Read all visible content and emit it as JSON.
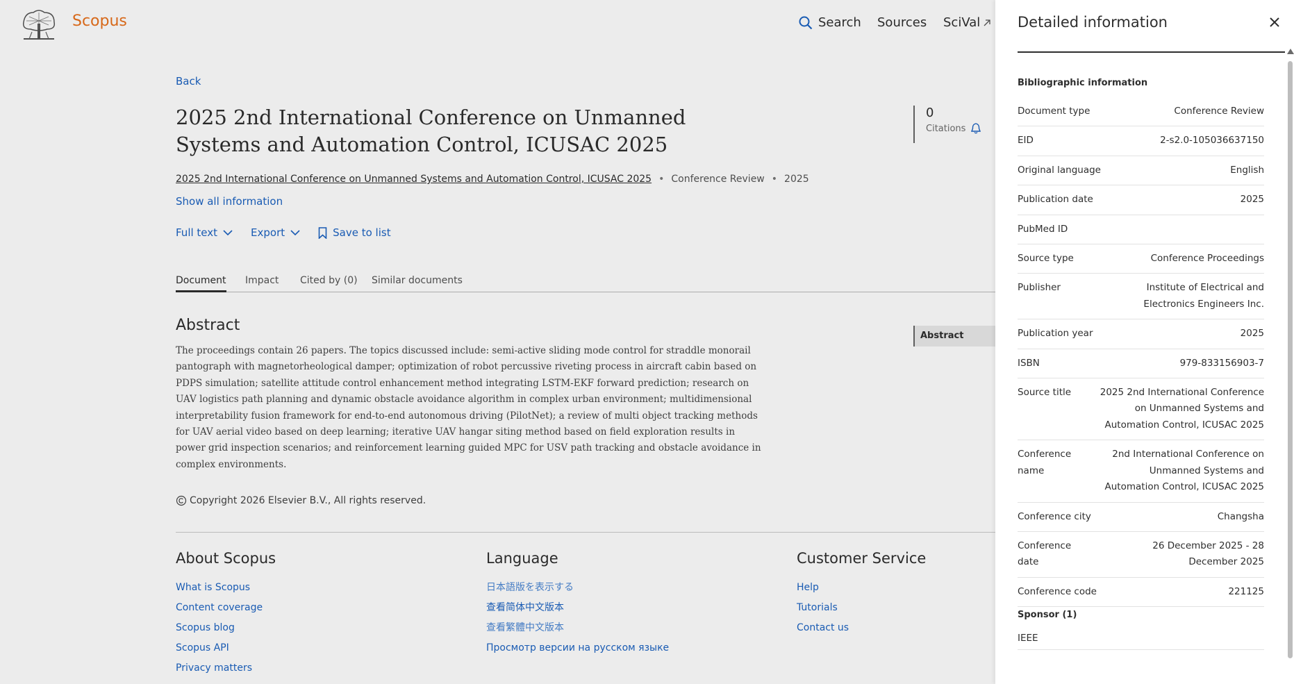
{
  "header": {
    "brand": "Scopus",
    "nav": {
      "search": "Search",
      "sources": "Sources",
      "scival": "SciVal"
    }
  },
  "main": {
    "back": "Back",
    "title": "2025 2nd International Conference on Unmanned Systems and Automation Control, ICUSAC 2025",
    "citations": {
      "count": "0",
      "label": "Citations"
    },
    "meta": {
      "source": "2025 2nd International Conference on Unmanned Systems and Automation Control, ICUSAC 2025",
      "doc_type": "Conference Review",
      "year": "2025"
    },
    "show_all": "Show all information",
    "actions": {
      "full_text": "Full text",
      "export": "Export",
      "save": "Save to list"
    },
    "tabs": [
      "Document",
      "Impact",
      "Cited by (0)",
      "Similar documents"
    ],
    "abstract": {
      "heading": "Abstract",
      "text": "The proceedings contain 26 papers. The topics discussed include: semi-active sliding mode control for straddle monorail pantograph with magnetorheological damper; optimization of robot percussive riveting process in aircraft cabin based on PDPS simulation; satellite attitude control enhancement method integrating LSTM-EKF forward prediction; research on UAV logistics path planning and dynamic obstacle avoidance algorithm in complex urban environment; multidimensional interpretability fusion framework for end-to-end autonomous driving (PilotNet); a review of multi object tracking methods for UAV aerial video based on deep learning; iterative UAV hangar siting method based on field exploration results in power grid inspection scenarios; and reinforcement learning guided MPC for USV path tracking and obstacle avoidance in complex environments."
    },
    "toc_item": "Abstract",
    "copyright": "Copyright 2026 Elsevier B.V., All rights reserved."
  },
  "footer": {
    "about": {
      "heading": "About Scopus",
      "links": [
        "What is Scopus",
        "Content coverage",
        "Scopus blog",
        "Scopus API",
        "Privacy matters"
      ]
    },
    "language": {
      "heading": "Language",
      "links": [
        "日本語版を表示する",
        "查看简体中文版本",
        "查看繁體中文版本",
        "Просмотр версии на русском языке"
      ]
    },
    "service": {
      "heading": "Customer Service",
      "links": [
        "Help",
        "Tutorials",
        "Contact us"
      ]
    }
  },
  "panel": {
    "title": "Detailed information",
    "bib_heading": "Bibliographic information",
    "rows": [
      {
        "label": "Document type",
        "value": "Conference Review"
      },
      {
        "label": "EID",
        "value": "2-s2.0-105036637150"
      },
      {
        "label": "Original language",
        "value": "English"
      },
      {
        "label": "Publication date",
        "value": "2025"
      },
      {
        "label": "PubMed ID",
        "value": ""
      },
      {
        "label": "Source type",
        "value": "Conference Proceedings"
      },
      {
        "label": "Publisher",
        "value": "Institute of Electrical and Electronics Engineers Inc."
      },
      {
        "label": "Publication year",
        "value": "2025"
      },
      {
        "label": "ISBN",
        "value": "979-833156903-7"
      },
      {
        "label": "Source title",
        "value": "2025 2nd International Conference on Unmanned Systems and Automation Control, ICUSAC 2025"
      },
      {
        "label": "Conference name",
        "value": "2nd International Conference on Unmanned Systems and Automation Control, ICUSAC 2025"
      },
      {
        "label": "Conference city",
        "value": "Changsha"
      },
      {
        "label": "Conference date",
        "value": "26 December 2025 - 28 December 2025"
      },
      {
        "label": "Conference code",
        "value": "221125"
      }
    ],
    "sponsor_heading": "Sponsor (1)",
    "sponsor": "IEEE"
  },
  "colors": {
    "brand": "#e9711c",
    "link": "#1c63c2",
    "text": "#2e2e2e"
  },
  "icons": [
    "elsevier-tree-logo",
    "search-icon",
    "external-link-icon",
    "bell-icon",
    "chevron-down-icon",
    "bookmark-icon",
    "copyright-icon",
    "close-icon"
  ]
}
